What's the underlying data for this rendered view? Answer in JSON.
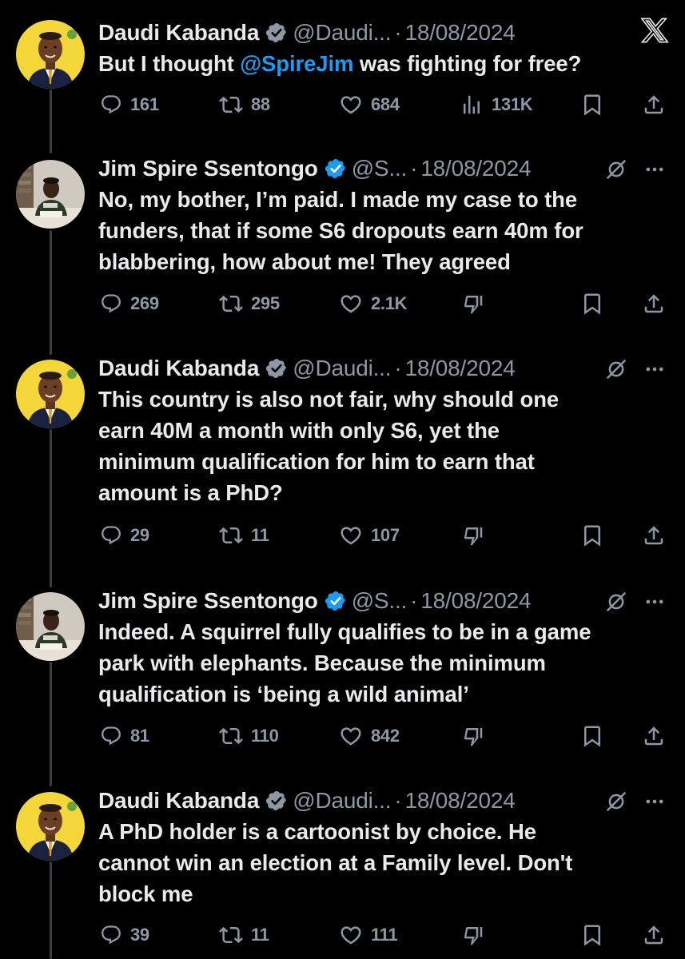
{
  "header": {
    "x_logo": "x-logo-icon"
  },
  "colors": {
    "background": "#000000",
    "text": "#e7e9ea",
    "muted": "#8b98a5",
    "mention": "#1d9bf0",
    "verified": "#1d9bf0",
    "daudi_verified": "#8b98a5"
  },
  "tweets": [
    {
      "name": "Daudi Kabanda",
      "verified": "grey",
      "handle": "@Daudi...",
      "sep": "·",
      "date": "18/08/2024",
      "text_before": "But I thought ",
      "mention": "@SpireJim",
      "text_after": " was fighting for free?",
      "replies": "161",
      "reposts": "88",
      "likes": "684",
      "views": "131K"
    },
    {
      "name": "Jim Spire Ssentongo",
      "verified": "blue",
      "handle": "@S...",
      "sep": "·",
      "date": "18/08/2024",
      "lines": [
        "No, my bother, I’m paid. I made my case to the",
        "funders, that if some S6 dropouts earn 40m for",
        "blabbering, how about me! They agreed"
      ],
      "replies": "269",
      "reposts": "295",
      "likes": "2.1K"
    },
    {
      "name": "Daudi Kabanda",
      "verified": "grey",
      "handle": "@Daudi...",
      "sep": "·",
      "date": "18/08/2024",
      "lines": [
        "This country is also not fair, why should one",
        "earn 40M a month with only S6, yet the",
        "minimum qualification for him to earn that",
        "amount is a PhD?"
      ],
      "replies": "29",
      "reposts": "11",
      "likes": "107"
    },
    {
      "name": "Jim Spire Ssentongo",
      "verified": "blue",
      "handle": "@S...",
      "sep": "·",
      "date": "18/08/2024",
      "lines": [
        "Indeed. A squirrel fully qualifies to be in a game",
        "park with elephants. Because the minimum",
        "qualification is ‘being a wild animal’"
      ],
      "replies": "81",
      "reposts": "110",
      "likes": "842"
    },
    {
      "name": "Daudi Kabanda",
      "verified": "grey",
      "handle": "@Daudi...",
      "sep": "·",
      "date": "18/08/2024",
      "lines": [
        "A PhD holder is a cartoonist by choice. He",
        "cannot win an election at a Family level. Don't",
        "block me"
      ],
      "replies": "39",
      "reposts": "11",
      "likes": "111"
    }
  ],
  "icons": [
    "reply-icon",
    "repost-icon",
    "like-icon",
    "views-icon",
    "bookmark-icon",
    "share-icon",
    "grok-icon",
    "more-icon",
    "downvote-icon",
    "verified-badge-icon"
  ]
}
